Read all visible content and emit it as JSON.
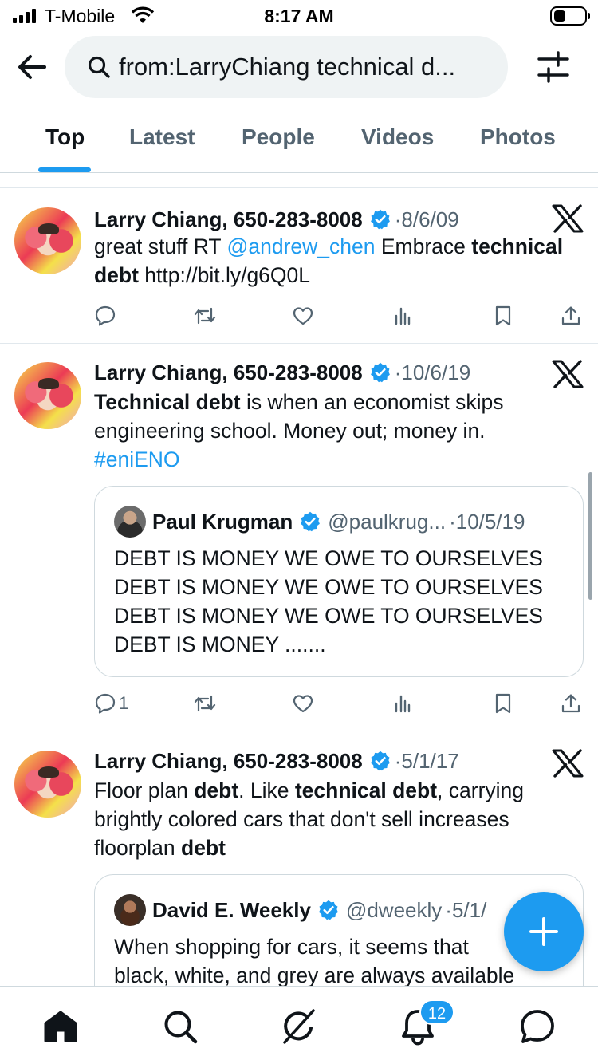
{
  "status_bar": {
    "carrier": "T-Mobile",
    "time": "8:17 AM",
    "battery_level": 0.4
  },
  "search": {
    "query": "from:LarryChiang technical d..."
  },
  "tabs": [
    {
      "label": "Top",
      "active": true
    },
    {
      "label": "Latest",
      "active": false
    },
    {
      "label": "People",
      "active": false
    },
    {
      "label": "Videos",
      "active": false
    },
    {
      "label": "Photos",
      "active": false
    }
  ],
  "tweets": [
    {
      "author": "Larry Chiang, 650-283-8008",
      "date": "8/6/09",
      "text": {
        "p1": "great stuff RT ",
        "mention": "@andrew_chen",
        "p2": " Embrace ",
        "bold1": "technical debt",
        "p3": " http://bit.ly/g6Q0L"
      },
      "reply_count": ""
    },
    {
      "author": "Larry Chiang, 650-283-8008",
      "date": "10/6/19",
      "text": {
        "bold1": "Technical debt",
        "p1": " is when an economist skips engineering school. Money out; money in.",
        "hashtag": "#eniENO"
      },
      "quote": {
        "author": "Paul Krugman",
        "handle": "@paulkrug...",
        "date": "10/5/19",
        "lines": [
          "DEBT IS MONEY WE OWE TO OURSELVES",
          "DEBT IS MONEY WE OWE TO OURSELVES",
          "DEBT IS MONEY WE OWE TO OURSELVES",
          "DEBT IS MONEY ......."
        ]
      },
      "reply_count": "1"
    },
    {
      "author": "Larry Chiang, 650-283-8008",
      "date": "5/1/17",
      "text": {
        "p1": "Floor plan ",
        "bold1": "debt",
        "p2": ". Like ",
        "bold2": "technical debt",
        "p3": ", carrying brightly colored cars that don't sell increases floorplan ",
        "bold3": "debt"
      },
      "quote": {
        "author": "David E. Weekly",
        "handle": "@dweekly",
        "date": "5/1/",
        "lines": [
          "When shopping for cars, it seems that",
          "black, white, and grey are always available"
        ]
      }
    }
  ],
  "date_separator": "·",
  "notifications_badge": "12",
  "icons": {
    "back": "back-arrow-icon",
    "search": "search-icon",
    "filter": "filter-sliders-icon",
    "verified": "verified-badge-icon",
    "x": "x-logo-icon",
    "reply": "reply-icon",
    "repost": "repost-icon",
    "like": "like-icon",
    "views": "views-icon",
    "bookmark": "bookmark-icon",
    "share": "share-icon",
    "compose": "plus-icon",
    "home": "home-icon",
    "explore": "search-icon",
    "grok": "grok-icon",
    "notifications": "bell-icon",
    "messages": "message-icon"
  },
  "colors": {
    "accent": "#1d9bf0",
    "text": "#0f1419",
    "secondary": "#536471"
  }
}
